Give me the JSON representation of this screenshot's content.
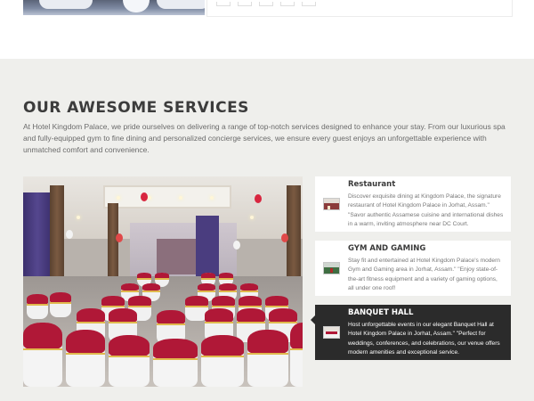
{
  "section": {
    "title": "OUR AWESOME SERVICES",
    "description": "At Hotel Kingdom Palace, we pride ourselves on delivering a range of top-notch services designed to enhance your stay. From our luxurious spa and fully-equipped gym to fine dining and personalized concierge services, we ensure every guest enjoys an unforgettable experience with unmatched comfort and convenience."
  },
  "services": [
    {
      "name": "Restaurant",
      "text": "Discover exquisite dining at Kingdom Palace, the signature restaurant of Hotel Kingdom Palace in Jorhat, Assam.\" \"Savor authentic Assamese cuisine and international dishes in a warm, inviting atmosphere near DC Court.",
      "icon": "restaurant-icon",
      "active": false
    },
    {
      "name": "GYM AND GAMING",
      "text": "Stay fit and entertained at Hotel Kingdom Palace's modern Gym and Gaming area in Jorhat, Assam.\" \"Enjoy state-of-the-art fitness equipment and a variety of gaming options, all under one roof!",
      "icon": "gym-icon",
      "active": false
    },
    {
      "name": "BANQUET HALL",
      "text": "Host unforgettable events in our elegant Banquet Hall at Hotel Kingdom Palace in Jorhat, Assam.\" \"Perfect for weddings, conferences, and celebrations, our venue offers modern amenities and exceptional service.",
      "icon": "banquet-hall-icon",
      "active": true
    }
  ],
  "colors": {
    "section_bg": "#efefec",
    "active_card_bg": "#2b2b2b",
    "chair_red": "#b01837"
  }
}
